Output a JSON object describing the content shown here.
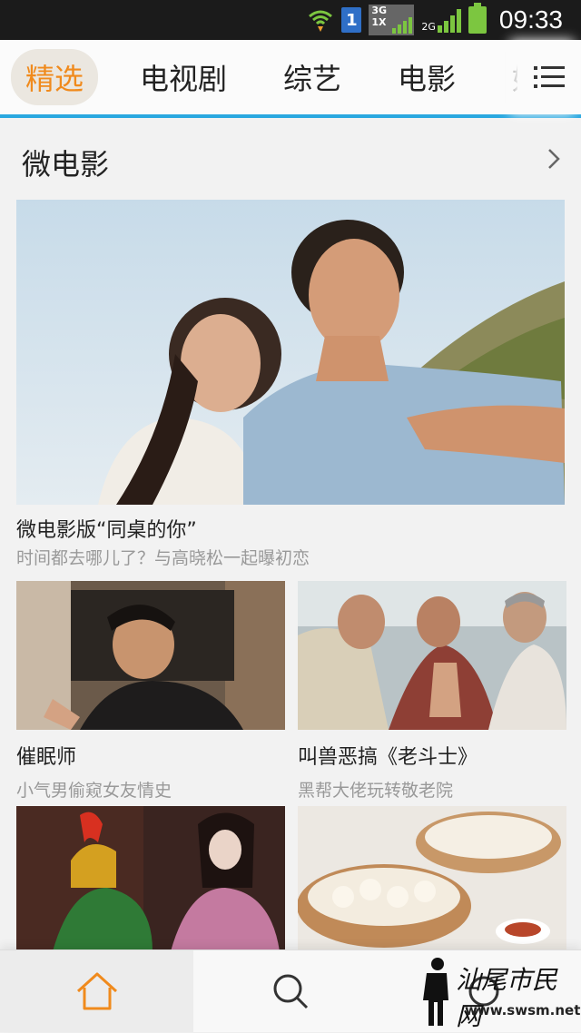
{
  "status_bar": {
    "sim_slot": "1",
    "network_3g": "3G",
    "network_1x": "1X",
    "network_2g": "2G",
    "time": "09:33",
    "icons": [
      "wifi-icon",
      "sim-icon",
      "network-icon",
      "signal-icon",
      "battery-icon"
    ]
  },
  "tabs": [
    {
      "label": "精选",
      "active": true
    },
    {
      "label": "电视剧",
      "active": false
    },
    {
      "label": "综艺",
      "active": false
    },
    {
      "label": "电影",
      "active": false
    },
    {
      "label": "好莱",
      "active": false
    }
  ],
  "section": {
    "title": "微电影"
  },
  "hero": {
    "title": "微电影版“同桌的你”",
    "subtitle": "时间都去哪儿了？与高晓松一起曝初恋"
  },
  "cards": [
    {
      "title": "催眠师",
      "subtitle": "小气男偷窥女友情史"
    },
    {
      "title": "叫兽恶搞《老斗士》",
      "subtitle": "黑帮大佬玩转敬老院"
    },
    {
      "title": "",
      "subtitle": ""
    },
    {
      "title": "",
      "subtitle": ""
    }
  ],
  "bottom_nav": [
    {
      "icon": "home-icon",
      "active": true
    },
    {
      "icon": "search-icon",
      "active": false
    },
    {
      "icon": "profile-icon",
      "active": false
    }
  ],
  "watermark": {
    "text": "汕尾市民网",
    "url": "www.swsm.net"
  },
  "colors": {
    "accent_orange": "#f08a1c",
    "tab_underline": "#29a8e0",
    "status_bar_bg": "#1b1b1b",
    "signal_green": "#7cc640"
  }
}
